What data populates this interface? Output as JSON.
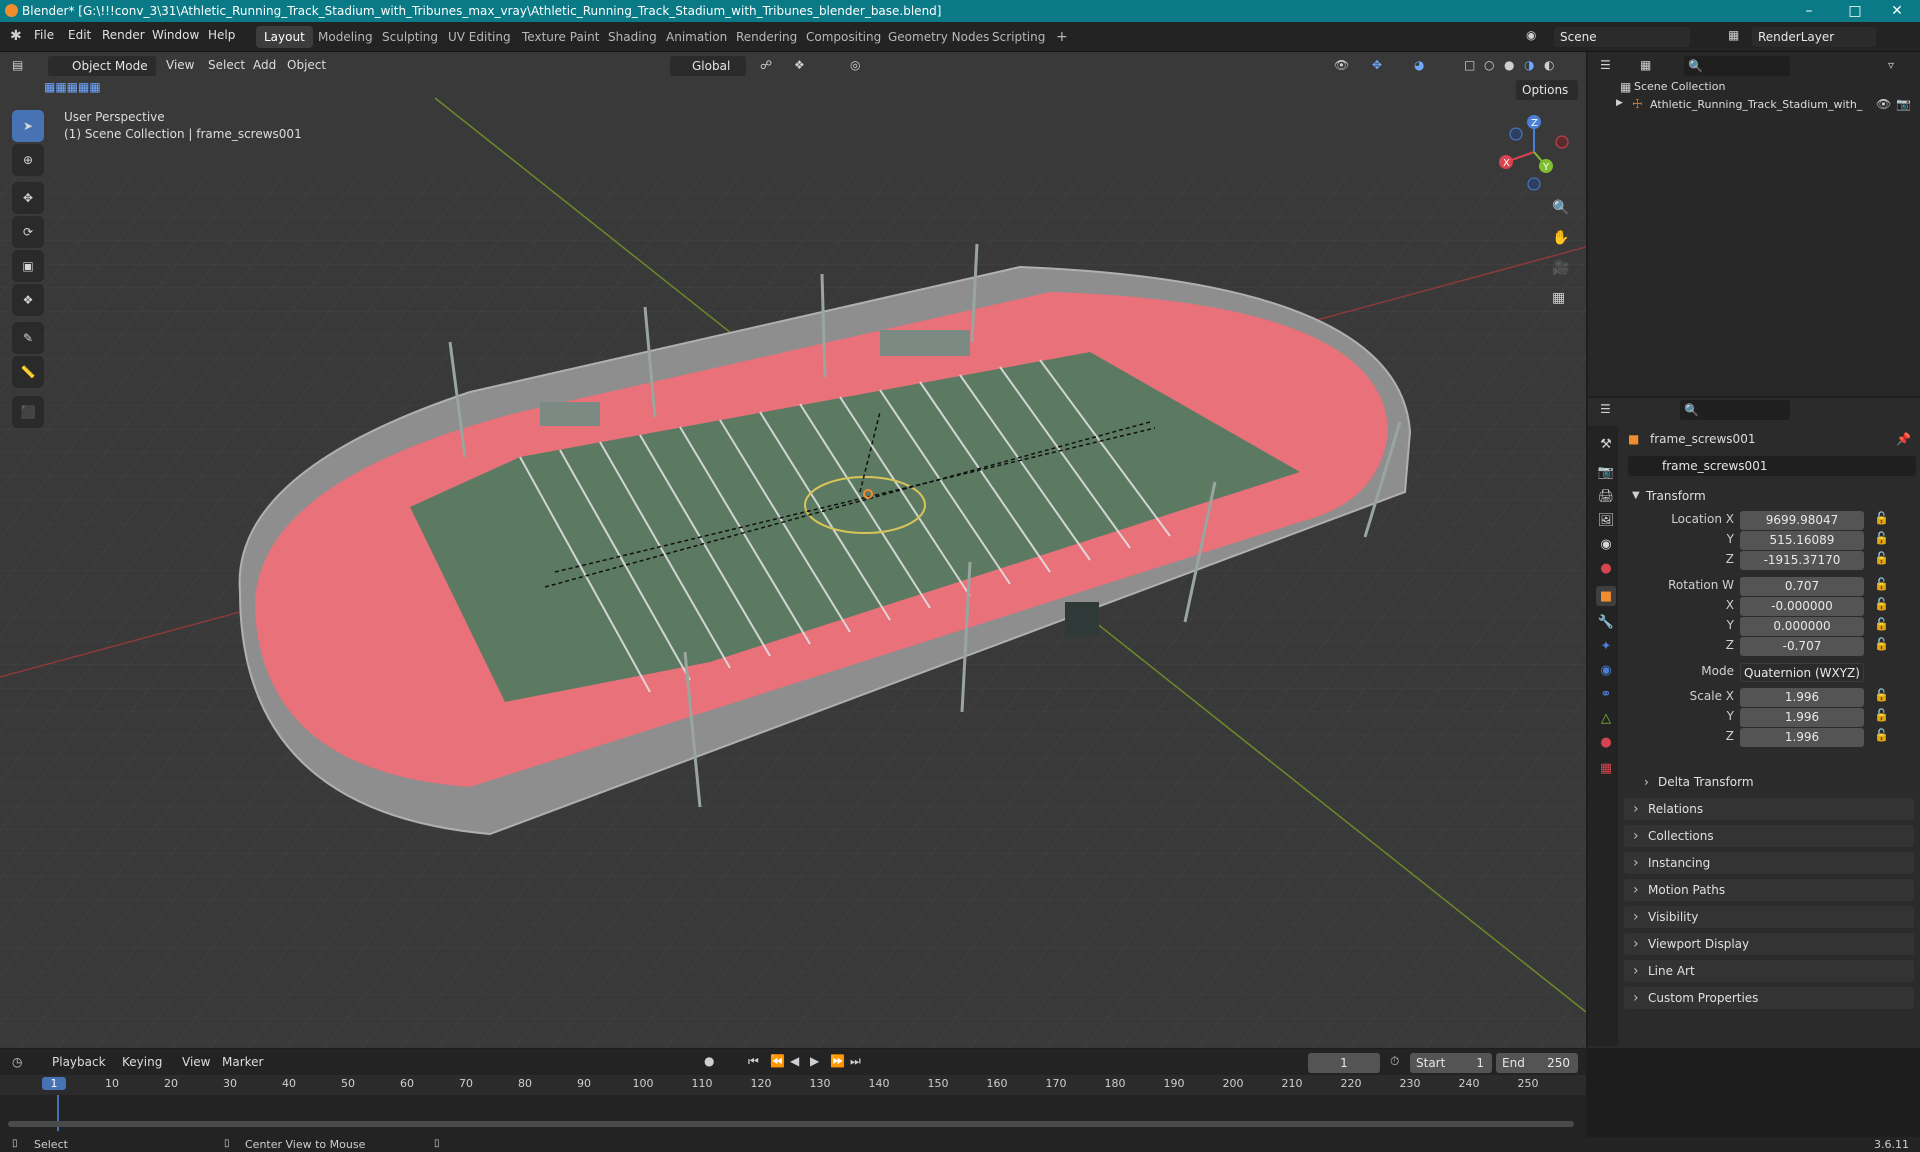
{
  "window": {
    "title": "Blender* [G:\\!!!conv_3\\31\\Athletic_Running_Track_Stadium_with_Tribunes_max_vray\\Athletic_Running_Track_Stadium_with_Tribunes_blender_base.blend]",
    "minimize": "–",
    "maximize": "□",
    "close": "✕"
  },
  "menu": [
    "File",
    "Edit",
    "Render",
    "Window",
    "Help"
  ],
  "workspaces": [
    "Layout",
    "Modeling",
    "Sculpting",
    "UV Editing",
    "Texture Paint",
    "Shading",
    "Animation",
    "Rendering",
    "Compositing",
    "Geometry Nodes",
    "Scripting"
  ],
  "active_workspace": "Layout",
  "add_workspace": "+",
  "scene": {
    "name": "Scene",
    "render_layer": "RenderLayer"
  },
  "viewport": {
    "mode": "Object Mode",
    "menus": [
      "View",
      "Select",
      "Add",
      "Object"
    ],
    "orientation": "Global",
    "options": "Options",
    "overlay_title": "User Perspective",
    "overlay_subtitle": "(1) Scene Collection | frame_screws001",
    "gizmo": {
      "x": "X",
      "y": "Y",
      "z": "Z"
    }
  },
  "outliner": {
    "root": "Scene Collection",
    "items": [
      {
        "label": "Athletic_Running_Track_Stadium_with_"
      }
    ]
  },
  "properties": {
    "object_name": "frame_screws001",
    "data_name": "frame_screws001",
    "transform_label": "Transform",
    "location": {
      "label": "Location X",
      "x": "9699.98047",
      "y": "515.16089",
      "z": "-1915.37170"
    },
    "rotation": {
      "label": "Rotation W",
      "w": "0.707",
      "x": "-0.000000",
      "y": "0.000000",
      "z": "-0.707"
    },
    "mode_label": "Mode",
    "mode_value": "Quaternion (WXYZ)",
    "scale": {
      "label": "Scale X",
      "x": "1.996",
      "y": "1.996",
      "z": "1.996"
    },
    "axis_y": "Y",
    "axis_z": "Z",
    "axis_x": "X",
    "delta": "Delta Transform",
    "panels": [
      "Relations",
      "Collections",
      "Instancing",
      "Motion Paths",
      "Visibility",
      "Viewport Display",
      "Line Art",
      "Custom Properties"
    ]
  },
  "timeline": {
    "menus": [
      "Playback",
      "Keying",
      "View",
      "Marker"
    ],
    "current_frame": "1",
    "start_label": "Start",
    "start": "1",
    "end_label": "End",
    "end": "250",
    "ruler": [
      "1",
      "10",
      "20",
      "30",
      "40",
      "50",
      "60",
      "70",
      "80",
      "90",
      "100",
      "110",
      "120",
      "130",
      "140",
      "150",
      "160",
      "170",
      "180",
      "190",
      "200",
      "210",
      "220",
      "230",
      "240",
      "250"
    ]
  },
  "status": {
    "select": "Select",
    "center": "Center View to Mouse",
    "version": "3.6.11"
  },
  "colors": {
    "accent": "#4772b3",
    "title_bar": "#0a7a86",
    "track": "#e8717a",
    "grass": "#5c7a62"
  }
}
